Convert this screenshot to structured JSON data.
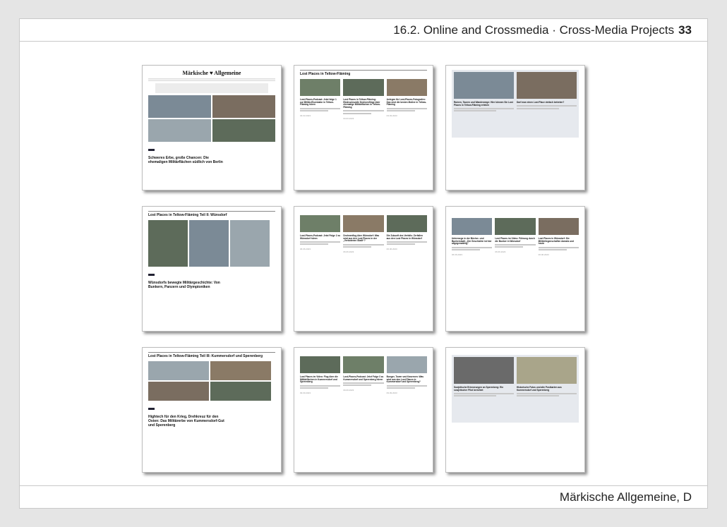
{
  "header": {
    "section": "16.2. Online and Crossmedia · Cross-Media Projects",
    "page_number": "33"
  },
  "footer": {
    "caption": "Märkische Allgemeine, D"
  },
  "pages": {
    "p1": {
      "logo": "Märkische ♥ Allgemeine",
      "headline": "Schweres Erbe, große Chancen: Die ehemaligen Militärflächen südlich von Berlin"
    },
    "p2": {
      "title": "Lost Places in Teltow-Fläming",
      "c1": "Lost-Places-Podcast: Jetzt folge 1 zur Militär-Eisenbahn in Teltow-Fläming hören",
      "c2": "Lost Places in Teltow-Fläming: Eindrucksvolle Drohnenflüge über ehemalige Militärflächen in Teltow-Fläming",
      "c3": "Anlegen für Lost-Places-Fotografen: Das sind die besten Motive in Teltow-Fläming"
    },
    "p3": {
      "h1": "Ruinen, Tauren und Wanderwege: Hier können Sie Lost Places in Teltow-Fläming erleben",
      "h2": "Darf man einen Lost Place einfach betreten?"
    },
    "p4": {
      "title": "Lost Places in Teltow-Fläming Teil II: Wünsdorf",
      "headline": "Wünsdorfs bewegte Militärgeschichte: Von Bunkern, Panzern und Olympioniken"
    },
    "p5": {
      "c1": "Lost-Places-Podcast: Jetzt Folge 2 zu Wünsdorf hören",
      "c2": "Drohnenflug über Wünsdorf: Was wird aus den Lost Places in der „Verbotenen Stadt“?",
      "c3": "Die Zukunft des Verfalls: Zerfallen aus den Lost Places in Wünsdorf"
    },
    "p6": {
      "c1": "Unterwegs in der Bücher- und Bunkerstadt: „Die Geschichte ist hier allgegenwärtig“",
      "c2": "Lost Places im Video: Führung durch die Bunker in Wünsdorf",
      "c3": "Lost Places in Wünsdorf: Die Militärliegenschaften damals und heute"
    },
    "p7": {
      "title": "Lost Places in Teltow-Fläming Teil III: Kummersdorf und Sperenberg",
      "headline": "Hightech für den Krieg, Drehkreuz für den Osten: Das Militärerbe von Kummersdorf-Gut und Sperenberg"
    },
    "p8": {
      "c1": "Lost Places im Video: Flug über die Militärflächen in Kummersdorf und Sperenberg",
      "c2": "Lost-Places-Podcast: Jetzt Folge 3 zu Kummersdorf und Sperenberg hören",
      "c3": "Bunger, Tower und Kasernen: Was wird aus den Lost Places in Kummersdorf und Sperenberg?"
    },
    "p9": {
      "h1": "Sowjetische Erinnerungen an Sperenberg: Ein sowjetischer Pilot berichtet",
      "h2": "Historische Fotos und alte Postkarten aus Kummersdorf und Sperenberg"
    }
  }
}
